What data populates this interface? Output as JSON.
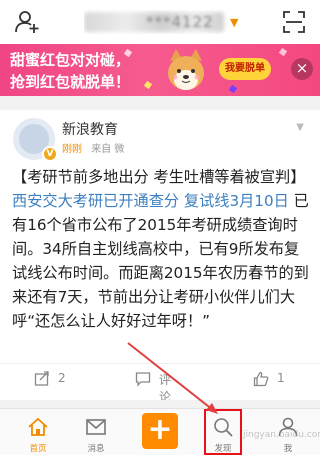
{
  "header": {
    "title": "***4122",
    "add_friend_icon": "add-user-icon",
    "scan_icon": "scan-icon"
  },
  "banner": {
    "line1": "甜蜜红包对对碰，",
    "line2": "抢到红包就脱单！",
    "button_label": "我要脱单",
    "close_label": "×",
    "color": "#f04585"
  },
  "post": {
    "author": "新浪教育",
    "time": "刚刚",
    "source": "来自 微",
    "body_prefix": "【考研节前多地出分 考生吐槽等着被宣判】",
    "body_link": "西安交大考研已开通查分 复试线3月10日",
    "body_rest": " 已有16个省市公布了2015年考研成绩查询时间。34所自主划线高校中，已有9所发布复试线公布时间。而距离2015年农历春节的到来还有7天，节前出分让考研小伙伴儿们大呼“还怎么让人好好过年呀！”",
    "actions": {
      "share_count": "2",
      "comment_label": "评论",
      "like_count": "1"
    }
  },
  "tabbar": {
    "items": [
      {
        "label": "首页",
        "icon": "home-icon"
      },
      {
        "label": "消息",
        "icon": "message-icon"
      },
      {
        "label": "",
        "icon": "plus-icon"
      },
      {
        "label": "发现",
        "icon": "discover-icon"
      },
      {
        "label": "我",
        "icon": "profile-icon"
      }
    ],
    "compose_label": "+",
    "accent": "#ff8c00"
  },
  "watermark": "jingyan.baidu.com"
}
